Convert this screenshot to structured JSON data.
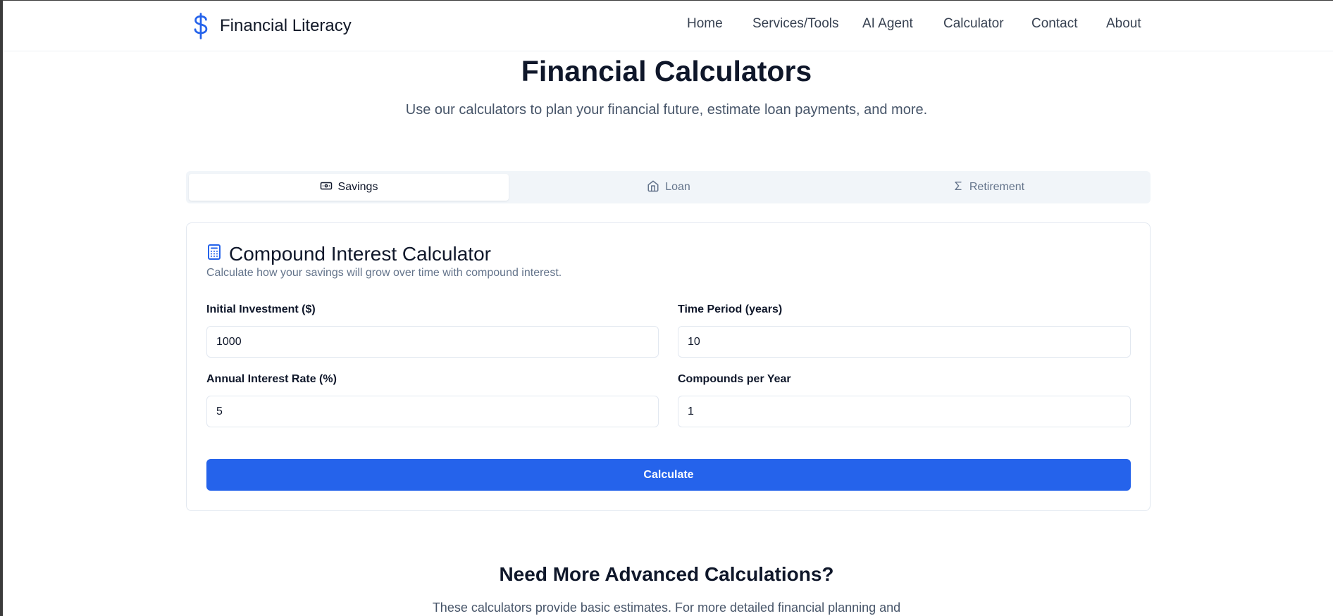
{
  "brand": {
    "name": "Financial Literacy",
    "icon": "dollar-sign-icon",
    "color": "#2563eb"
  },
  "nav": {
    "items": [
      {
        "label": "Home"
      },
      {
        "label": "Services/Tools"
      },
      {
        "label": "AI Agent"
      },
      {
        "label": "Calculator"
      },
      {
        "label": "Contact"
      },
      {
        "label": "About"
      }
    ]
  },
  "hero": {
    "title": "Financial Calculators",
    "subtitle": "Use our calculators to plan your financial future, estimate loan payments, and more."
  },
  "tabs": [
    {
      "label": "Savings",
      "icon": "banknote-icon",
      "active": true
    },
    {
      "label": "Loan",
      "icon": "home-icon",
      "active": false
    },
    {
      "label": "Retirement",
      "icon": "sigma-icon",
      "active": false
    }
  ],
  "calculator": {
    "title": "Compound Interest Calculator",
    "icon": "calculator-icon",
    "description": "Calculate how your savings will grow over time with compound interest.",
    "fields": {
      "initial_investment": {
        "label": "Initial Investment ($)",
        "value": "1000"
      },
      "time_period": {
        "label": "Time Period (years)",
        "value": "10"
      },
      "interest_rate": {
        "label": "Annual Interest Rate (%)",
        "value": "5"
      },
      "compounds": {
        "label": "Compounds per Year",
        "value": "1"
      }
    },
    "button_label": "Calculate"
  },
  "advanced": {
    "heading": "Need More Advanced Calculations?",
    "text": "These calculators provide basic estimates. For more detailed financial planning and"
  },
  "colors": {
    "accent": "#2563eb",
    "text": "#0f172a",
    "muted": "#64748b",
    "border": "#e2e8f0"
  }
}
